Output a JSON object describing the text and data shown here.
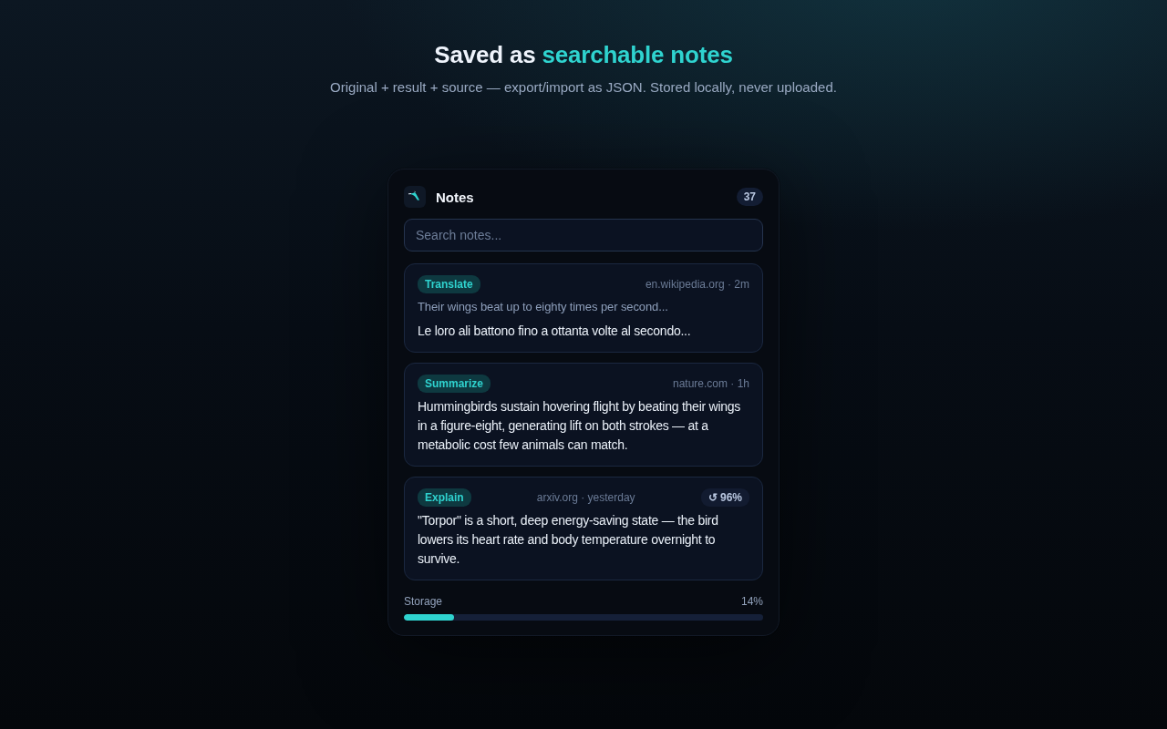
{
  "header": {
    "title": {
      "text": "Saved as",
      "highlight": "searchable notes"
    },
    "subtitle": "Original + result + source — export/import as JSON. Stored locally, never uploaded."
  },
  "panel": {
    "title": "Notes",
    "count": "37",
    "search": {
      "placeholder": "Search notes..."
    },
    "notes": [
      {
        "tag": "Translate",
        "meta": "en.wikipedia.org · 2m",
        "original": "Their wings beat up to eighty times per second...",
        "result": "Le loro ali battono fino a ottanta volte al secondo..."
      },
      {
        "tag": "Summarize",
        "meta": "nature.com · 1h",
        "result": "Hummingbirds sustain hovering flight by beating their wings in a figure-eight, generating lift on both strokes — at a metabolic cost few animals can match."
      },
      {
        "tag": "Explain",
        "meta": "arxiv.org · yesterday",
        "score": "↺ 96%",
        "result": "\"Torpor\" is a short, deep energy-saving state — the bird lowers its heart rate and body temperature overnight to survive."
      }
    ],
    "storage": {
      "label": "Storage",
      "value": "14%",
      "level": 0.14
    }
  }
}
